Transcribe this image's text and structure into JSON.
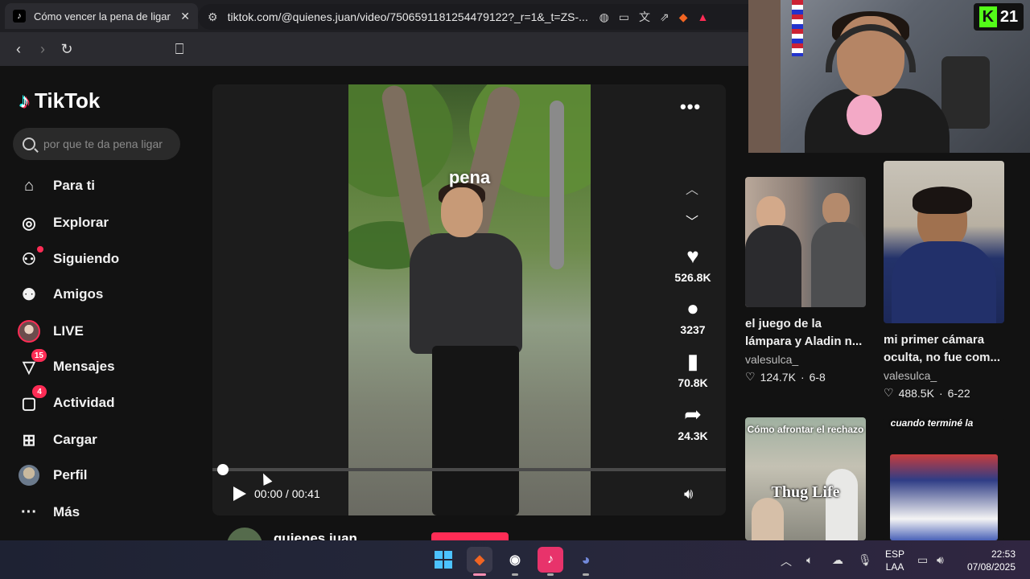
{
  "browser": {
    "tab_title": "Cómo vencer la pena de ligar | Ti",
    "url": "tiktok.com/@quienes.juan/video/7506591181254479122?_r=1&_t=ZS-..."
  },
  "sidebar": {
    "logo": "TikTok",
    "search_placeholder": "por que te da pena ligar",
    "items": [
      {
        "label": "Para ti",
        "icon": "home-icon"
      },
      {
        "label": "Explorar",
        "icon": "compass-icon"
      },
      {
        "label": "Siguiendo",
        "icon": "following-icon"
      },
      {
        "label": "Amigos",
        "icon": "friends-icon"
      },
      {
        "label": "LIVE",
        "icon": "live-avatar"
      },
      {
        "label": "Mensajes",
        "icon": "messages-icon",
        "badge": "15"
      },
      {
        "label": "Actividad",
        "icon": "activity-icon",
        "badge": "4"
      },
      {
        "label": "Cargar",
        "icon": "upload-icon"
      },
      {
        "label": "Perfil",
        "icon": "profile-avatar"
      },
      {
        "label": "Más",
        "icon": "more-icon"
      }
    ]
  },
  "video": {
    "overlay_text": "pena",
    "likes": "526.8K",
    "comments": "3237",
    "saves": "70.8K",
    "shares": "24.3K",
    "time": "00:00 / 00:41",
    "progress": 0.0,
    "author": "quienes.juan"
  },
  "recommendations": [
    {
      "title": "el juego de la lámpara y Aladin n...",
      "author": "valesulca_",
      "likes": "124.7K",
      "date": "6-8"
    },
    {
      "title": "mi primer cámara oculta, no fue com...",
      "author": "valesulca_",
      "likes": "488.5K",
      "date": "6-22"
    },
    {
      "thumb_text": "Cómo afrontar el rechazo",
      "thumb_logo": "Thug Life"
    },
    {
      "thumb_text": "cuando terminé la"
    }
  ],
  "webcam": {
    "badge": "21"
  },
  "taskbar": {
    "lang": "ESP",
    "lang2": "LAA",
    "time": "22:53",
    "date": "07/08/2025"
  },
  "colors": {
    "accent": "#fe2c55",
    "kick_green": "#53fc18"
  }
}
